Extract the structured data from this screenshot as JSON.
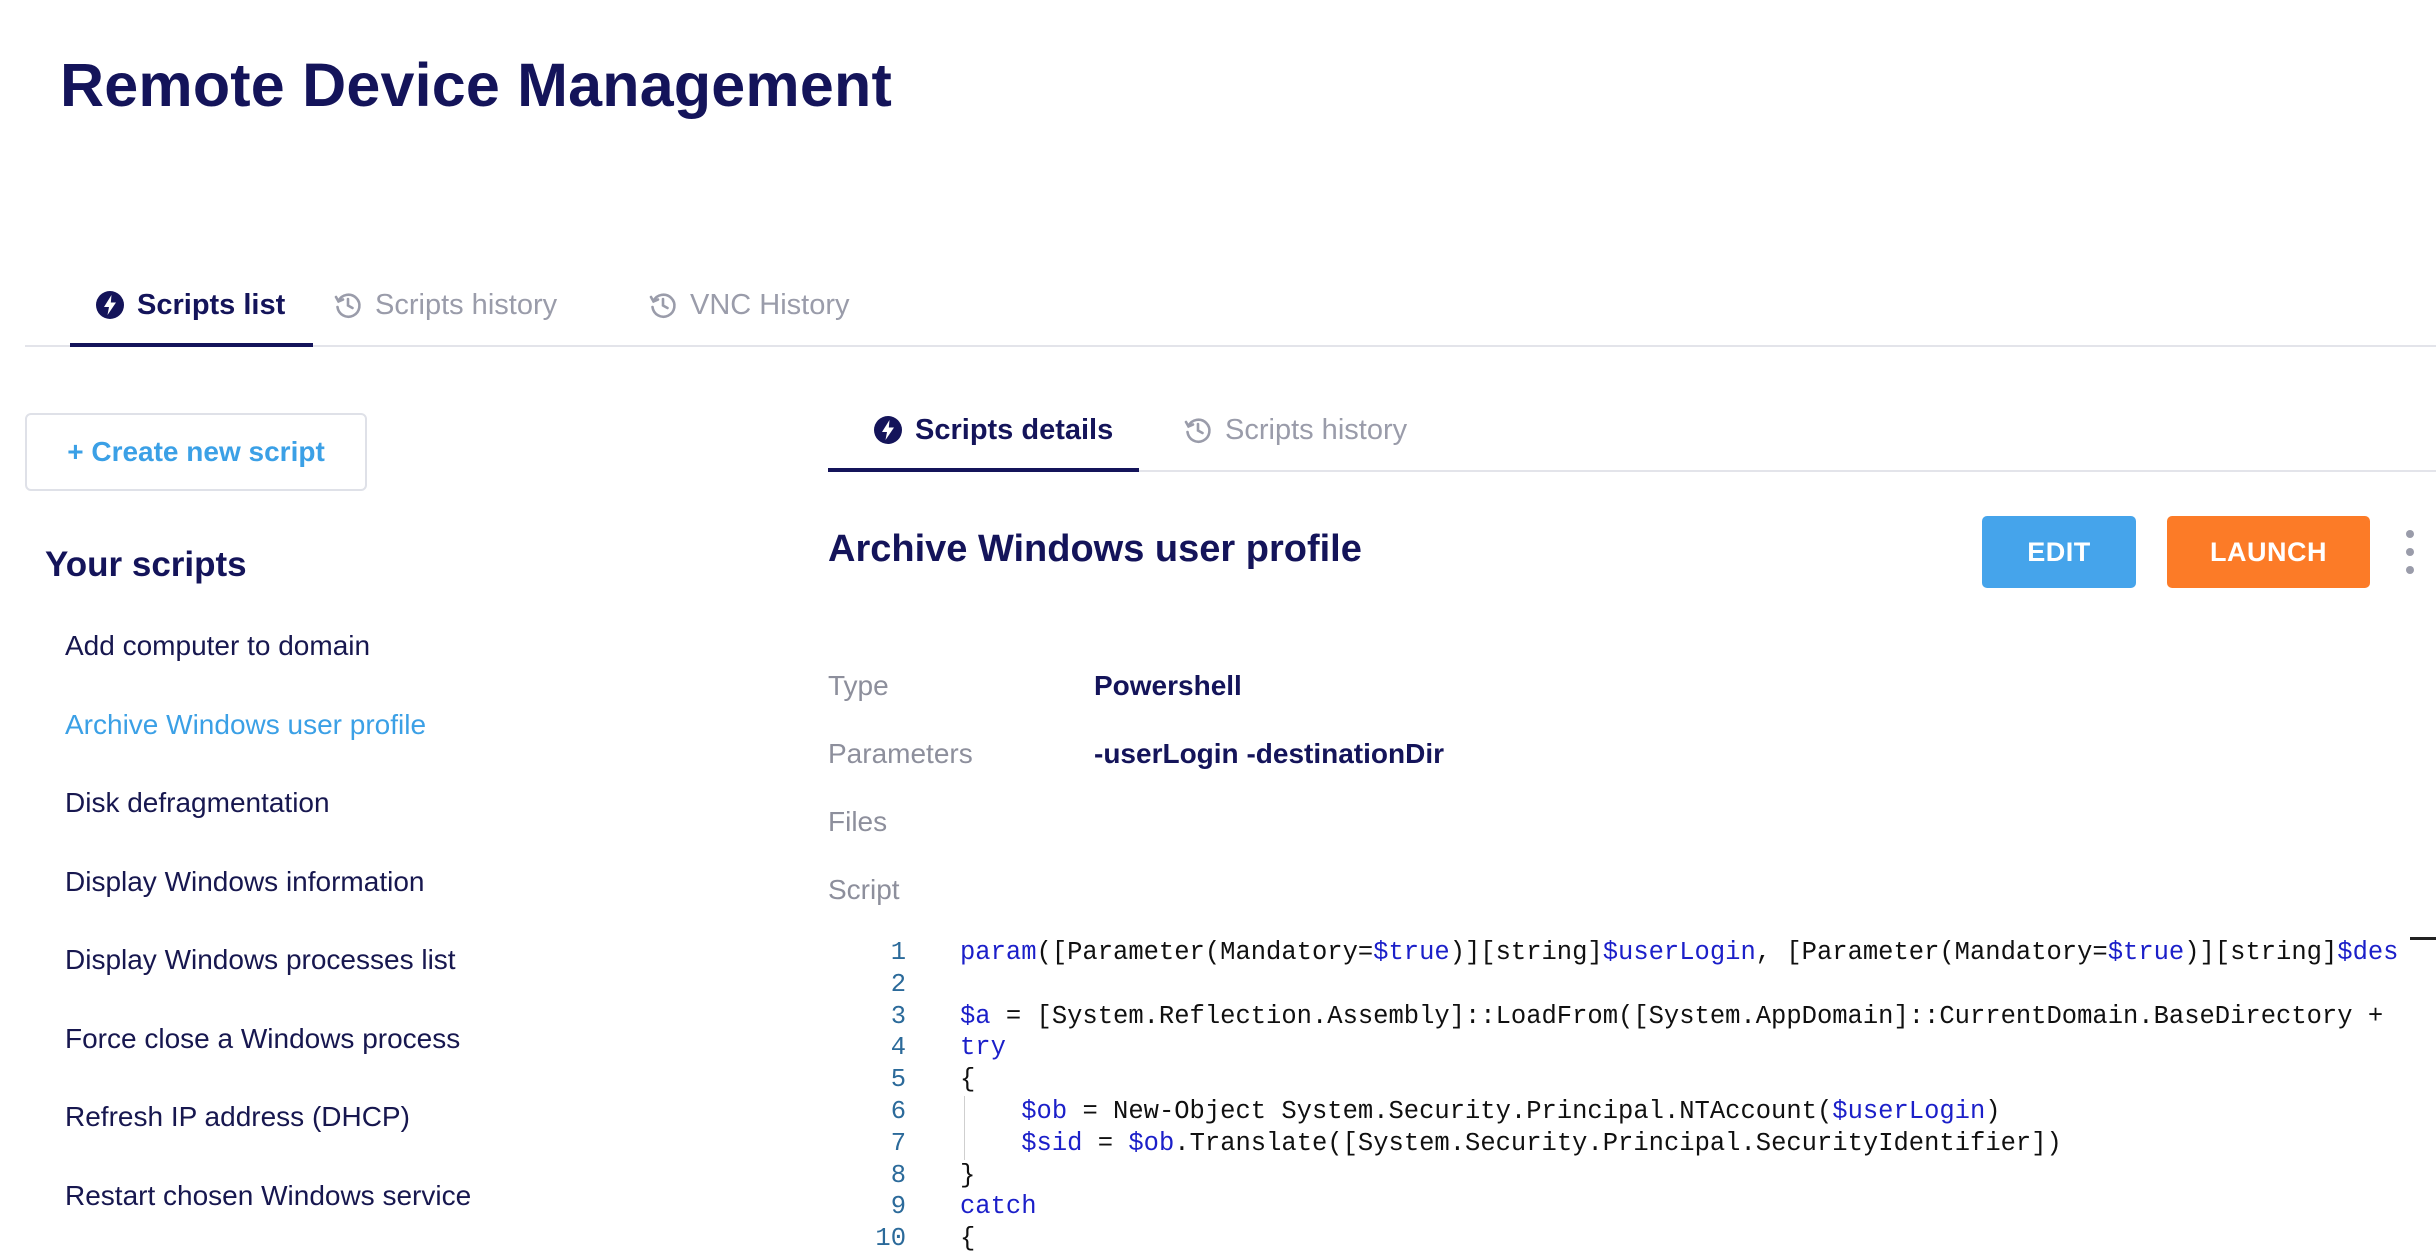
{
  "page": {
    "title": "Remote Device Management"
  },
  "top_tabs": [
    {
      "label": "Scripts list",
      "icon": "bolt-icon",
      "active": true
    },
    {
      "label": "Scripts history",
      "icon": "history-icon",
      "active": false
    },
    {
      "label": "VNC History",
      "icon": "history-icon",
      "active": false
    }
  ],
  "sidebar": {
    "create_button": "+ Create new script",
    "heading": "Your scripts",
    "items": [
      "Add computer to domain",
      "Archive Windows user profile",
      "Disk defragmentation",
      "Display Windows information",
      "Display Windows processes list",
      "Force close a Windows process",
      "Refresh IP address (DHCP)",
      "Restart chosen Windows service"
    ],
    "selected_index": 1
  },
  "detail_tabs": [
    {
      "label": "Scripts details",
      "icon": "bolt-icon",
      "active": true
    },
    {
      "label": "Scripts history",
      "icon": "history-icon",
      "active": false
    }
  ],
  "script": {
    "title": "Archive Windows user profile",
    "edit_label": "EDIT",
    "launch_label": "LAUNCH",
    "fields": {
      "type_label": "Type",
      "type_value": "Powershell",
      "parameters_label": "Parameters",
      "parameters_value": "-userLogin -destinationDir",
      "files_label": "Files",
      "script_label": "Script"
    },
    "code_lines": [
      "param([Parameter(Mandatory=$true)][string]$userLogin, [Parameter(Mandatory=$true)][string]$des",
      "",
      "$a = [System.Reflection.Assembly]::LoadFrom([System.AppDomain]::CurrentDomain.BaseDirectory +",
      "try",
      "{",
      "    $ob = New-Object System.Security.Principal.NTAccount($userLogin)",
      "    $sid = $ob.Translate([System.Security.Principal.SecurityIdentifier])",
      "}",
      "catch",
      "{"
    ]
  },
  "colors": {
    "primary_navy": "#14145a",
    "link_blue": "#3ba0e6",
    "edit_button": "#45a4eb",
    "launch_button": "#fc7b27",
    "muted_gray": "#9a9caa",
    "code_keyword": "#1b1fc9"
  }
}
